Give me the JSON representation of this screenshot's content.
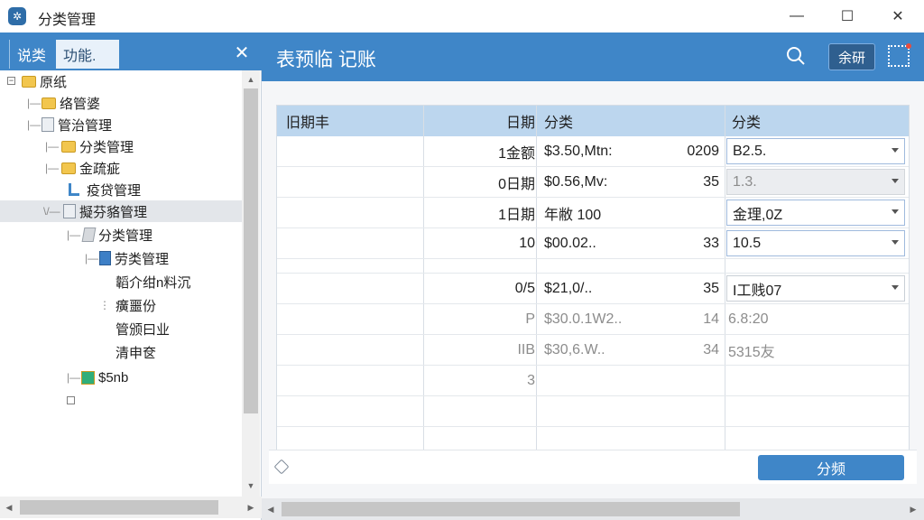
{
  "window": {
    "icon": "gear-app-icon",
    "title": "分类管理",
    "minimize": "—",
    "maximize": "☐",
    "close": "✕"
  },
  "left_panel": {
    "tabs": [
      "说类",
      "功能."
    ],
    "close": "✕",
    "tree": [
      {
        "label": "原纸",
        "icon": "folder-icon",
        "expander": "⊟"
      },
      {
        "label": "络管婆",
        "icon": "folder-icon"
      },
      {
        "label": "管治管理",
        "icon": "document-icon"
      },
      {
        "label": "分类管理",
        "icon": "folder-icon"
      },
      {
        "label": "金疏疵",
        "icon": "folder-icon"
      },
      {
        "label": "疫贷管理",
        "icon": "pin-icon"
      },
      {
        "label": "擬芬貉管理",
        "icon": "document-icon",
        "selected": true
      },
      {
        "label": "分类管理",
        "icon": "gray-document-icon"
      },
      {
        "label": "劳类管理",
        "icon": "blue-document-icon"
      },
      {
        "label": "韜介绀n料沉",
        "icon": ""
      },
      {
        "label": "癀噩份",
        "icon": ""
      },
      {
        "label": "管颁曰业",
        "icon": ""
      },
      {
        "label": "清申奁",
        "icon": ""
      },
      {
        "label": "$5nb",
        "icon": "green-package-icon"
      }
    ]
  },
  "right_panel": {
    "title": "表预临 记账",
    "search_icon": "search-icon",
    "header_button": "余研",
    "grid_icon": "grid-icon",
    "columns": [
      "旧期丰",
      "日期",
      "分类",
      "分类"
    ],
    "rows": [
      {
        "date": "1金额",
        "desc": "$3.50,Mtn:",
        "num": "0209",
        "cat": "B2.5.",
        "cat_style": "select"
      },
      {
        "date": "0日期",
        "desc": "$0.56,Mv:",
        "num": "35",
        "cat": "1.3.",
        "cat_style": "disabled"
      },
      {
        "date": "1日期",
        "desc": "年敝 100",
        "num": "",
        "cat": "金理,0Z",
        "cat_style": "select"
      },
      {
        "date": "10",
        "desc": "$00.02..",
        "num": "33",
        "cat": "10.5",
        "cat_style": "select"
      },
      {
        "date": "0/5",
        "desc": "$21,0/..",
        "num": "35",
        "cat": "I工贱07",
        "cat_style": "plain"
      },
      {
        "date": "P",
        "desc": "$30.0.1W2..",
        "num": "14",
        "cat": "6.8:20",
        "faded": true
      },
      {
        "date": "IIB",
        "desc": "$30,6.W..",
        "num": "34",
        "cat": "5315友",
        "faded": true
      },
      {
        "date": "3",
        "desc": "",
        "num": "",
        "cat": "",
        "faded": true
      }
    ],
    "action_button": "分频",
    "status_icon": "diamond-icon"
  },
  "colors": {
    "accent": "#3f86c8",
    "header_dark": "#2f5f8f",
    "table_header": "#bcd6ee",
    "selected_row": "#e3e6ea"
  }
}
